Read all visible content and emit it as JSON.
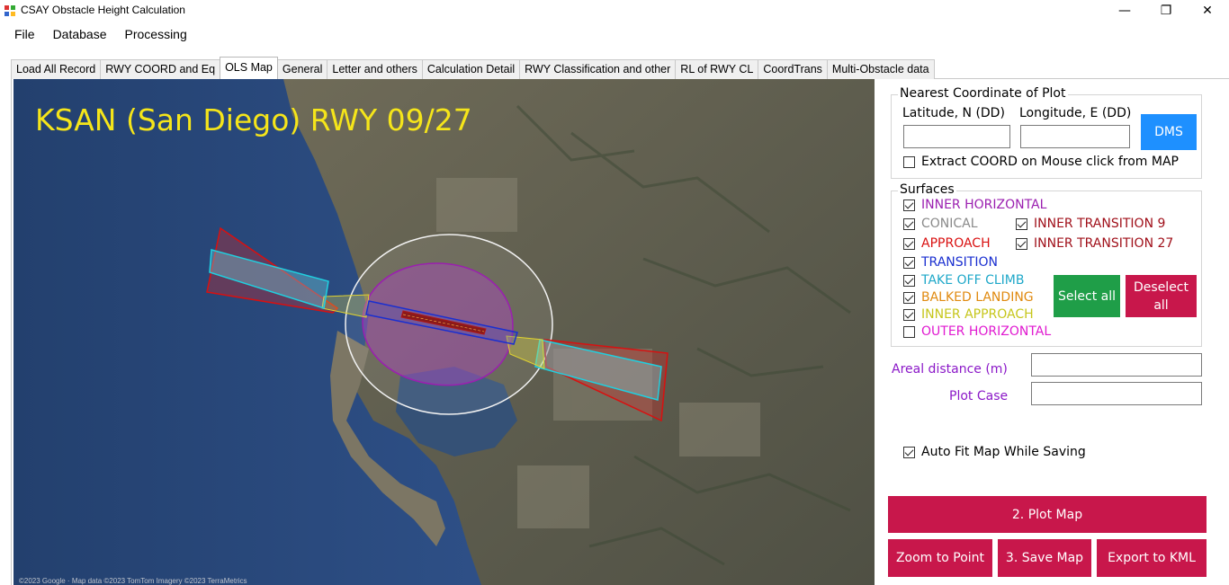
{
  "window": {
    "title": "CSAY Obstacle Height Calculation",
    "minimize_glyph": "—",
    "restore_glyph": "❐",
    "close_glyph": "✕"
  },
  "menu": [
    "File",
    "Database",
    "Processing"
  ],
  "tabs": [
    {
      "label": "Load All Record",
      "active": false
    },
    {
      "label": "RWY COORD and Eq",
      "active": false
    },
    {
      "label": "OLS Map",
      "active": true
    },
    {
      "label": "General",
      "active": false
    },
    {
      "label": "Letter and others",
      "active": false
    },
    {
      "label": "Calculation Detail",
      "active": false
    },
    {
      "label": "RWY Classification and other",
      "active": false
    },
    {
      "label": "RL of RWY CL",
      "active": false
    },
    {
      "label": "CoordTrans",
      "active": false
    },
    {
      "label": "Multi-Obstacle data",
      "active": false
    }
  ],
  "map": {
    "title": "KSAN (San Diego) RWY 09/27",
    "attribution": "©2023 Google · Map data ©2023 TomTom Imagery ©2023 TerraMetrics"
  },
  "nearest": {
    "group_title": "Nearest Coordinate of Plot",
    "lat_label": "Latitude, N (DD)",
    "lon_label": "Longitude, E (DD)",
    "lat_value": "",
    "lon_value": "",
    "dms_button": "DMS",
    "extract_label": "Extract COORD on Mouse click from MAP",
    "extract_checked": false
  },
  "surfaces": {
    "group_title": "Surfaces",
    "items": {
      "inner_horizontal": {
        "label": "INNER HORIZONTAL",
        "checked": true,
        "color": "#9b1fb0"
      },
      "conical": {
        "label": "CONICAL",
        "checked": true,
        "color": "#8a8a8a"
      },
      "inner_transition_9": {
        "label": "INNER TRANSITION 9",
        "checked": true,
        "color": "#a0101a"
      },
      "approach": {
        "label": "APPROACH",
        "checked": true,
        "color": "#d91010"
      },
      "inner_transition_27": {
        "label": "INNER TRANSITION 27",
        "checked": true,
        "color": "#a0101a"
      },
      "transition": {
        "label": "TRANSITION",
        "checked": true,
        "color": "#1a2fd0"
      },
      "take_off_climb": {
        "label": "TAKE OFF CLIMB",
        "checked": true,
        "color": "#1fa8c9"
      },
      "balked_landing": {
        "label": "BALKED LANDING",
        "checked": true,
        "color": "#e08a10"
      },
      "inner_approach": {
        "label": "INNER APPROACH",
        "checked": true,
        "color": "#c6c61a"
      },
      "outer_horizontal": {
        "label": "OUTER HORIZONTAL",
        "checked": false,
        "color": "#e01ad0"
      }
    },
    "select_all": "Select all",
    "deselect_all": "Deselect all"
  },
  "fields": {
    "areal_label": "Areal distance (m)",
    "areal_value": "",
    "plot_case_label": "Plot Case",
    "plot_case_value": ""
  },
  "auto_fit": {
    "label": "Auto Fit Map While Saving",
    "checked": true
  },
  "buttons": {
    "plot_map": "2. Plot Map",
    "zoom_to_point": "Zoom to Point",
    "save_map": "3. Save Map",
    "export_kml": "Export to KML"
  },
  "colors": {
    "accent_crimson": "#c8174b",
    "dms_blue": "#1e90ff",
    "select_green": "#1f9e48",
    "label_purple": "#8b18c8",
    "map_title_yellow": "#f5e51a"
  }
}
